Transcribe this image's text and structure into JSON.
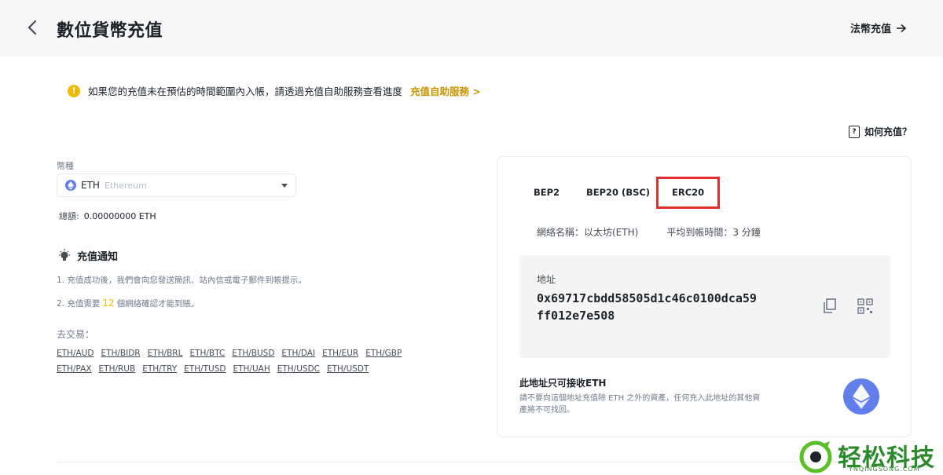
{
  "header": {
    "title": "數位貨幣充值",
    "fiat_link": "法幣充值"
  },
  "notice": {
    "text": "如果您的充值未在預估的時間範圍內入帳，請透過充值自助服務查看進度",
    "link": "充值自助服務 >"
  },
  "howto": {
    "label": "如何充值？"
  },
  "coin": {
    "label": "幣種",
    "code": "ETH",
    "name": "Ethereum",
    "balance_label": "總額:",
    "balance_value": "0.00000000 ETH"
  },
  "notification": {
    "title": "充值通知",
    "step1": "1. 充值成功後，我們會向您發送簡訊、站內信或電子郵件到帳提示。",
    "step2_prefix": "2. 充值需要",
    "step2_count": "12",
    "step2_suffix": "個網絡確認才能到賬。"
  },
  "trade": {
    "label": "去交易：",
    "pairs": [
      "ETH/AUD",
      "ETH/BIDR",
      "ETH/BRL",
      "ETH/BTC",
      "ETH/BUSD",
      "ETH/DAI",
      "ETH/EUR",
      "ETH/GBP",
      "ETH/PAX",
      "ETH/RUB",
      "ETH/TRY",
      "ETH/TUSD",
      "ETH/UAH",
      "ETH/USDC",
      "ETH/USDT"
    ]
  },
  "networks": {
    "tabs": [
      "BEP2",
      "BEP20 (BSC)",
      "ERC20"
    ],
    "selected": "ERC20",
    "network_name": "網絡名稱：以太坊(ETH)",
    "avg_time": "平均到帳時間：3 分鐘"
  },
  "address": {
    "label": "地址",
    "line1": "0x69717cbdd58505d1c46c0100dca59",
    "line2": "ff012e7e508"
  },
  "restriction": {
    "title": "此地址只可接收ETH",
    "desc": "請不要向這個地址充值除 ETH 之外的資產，任何充入此地址的其他資產將不可找回。"
  },
  "watermark": {
    "text": "轻松科技",
    "sub": "YNQINGSONG.COM"
  },
  "colors": {
    "accent": "#f0b90b",
    "highlight_box": "#e0302e",
    "eth": "#627eea"
  }
}
